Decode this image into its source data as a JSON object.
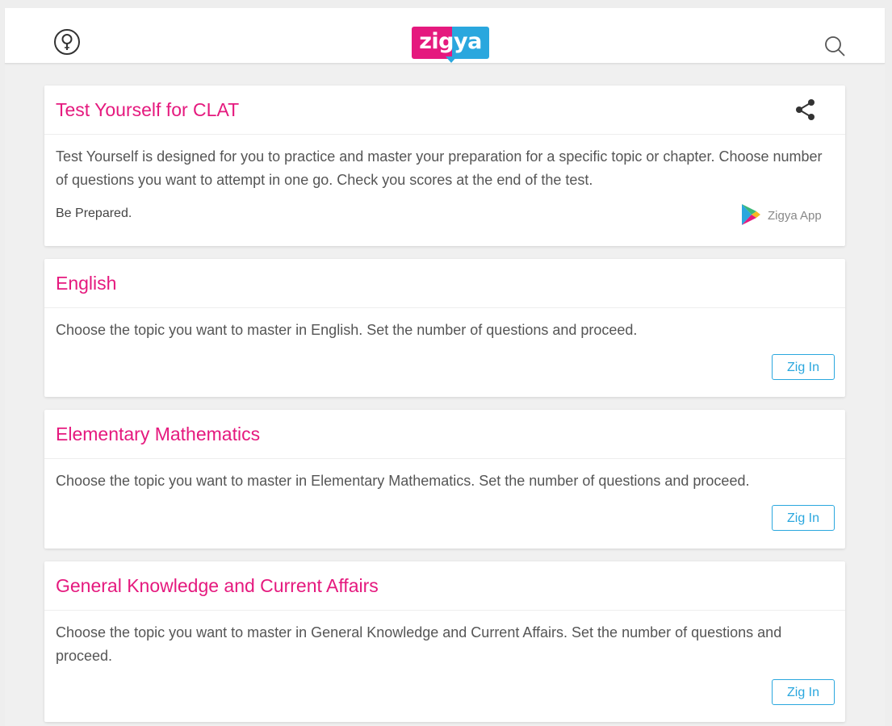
{
  "header": {
    "logo_text": "zigya",
    "icons": [
      "bulb-icon",
      "search-icon"
    ],
    "brand_colors": {
      "pink": "#e5197e",
      "blue": "#2aa7de"
    }
  },
  "intro": {
    "title": "Test Yourself for CLAT",
    "description": "Test Yourself is designed for you to practice and master your preparation for a specific topic or chapter. Choose number of questions you want to attempt in one go. Check you scores at the end of the test.",
    "tagline": "Be Prepared.",
    "app_label": "Zigya App"
  },
  "subjects": [
    {
      "title": "English",
      "description": "Choose the topic you want to master in English. Set the number of questions and proceed.",
      "button": "Zig In"
    },
    {
      "title": "Elementary Mathematics",
      "description": "Choose the topic you want to master in Elementary Mathematics. Set the number of questions and proceed.",
      "button": "Zig In"
    },
    {
      "title": "General Knowledge and Current Affairs",
      "description": "Choose the topic you want to master in General Knowledge and Current Affairs. Set the number of questions and proceed.",
      "button": "Zig In"
    }
  ]
}
